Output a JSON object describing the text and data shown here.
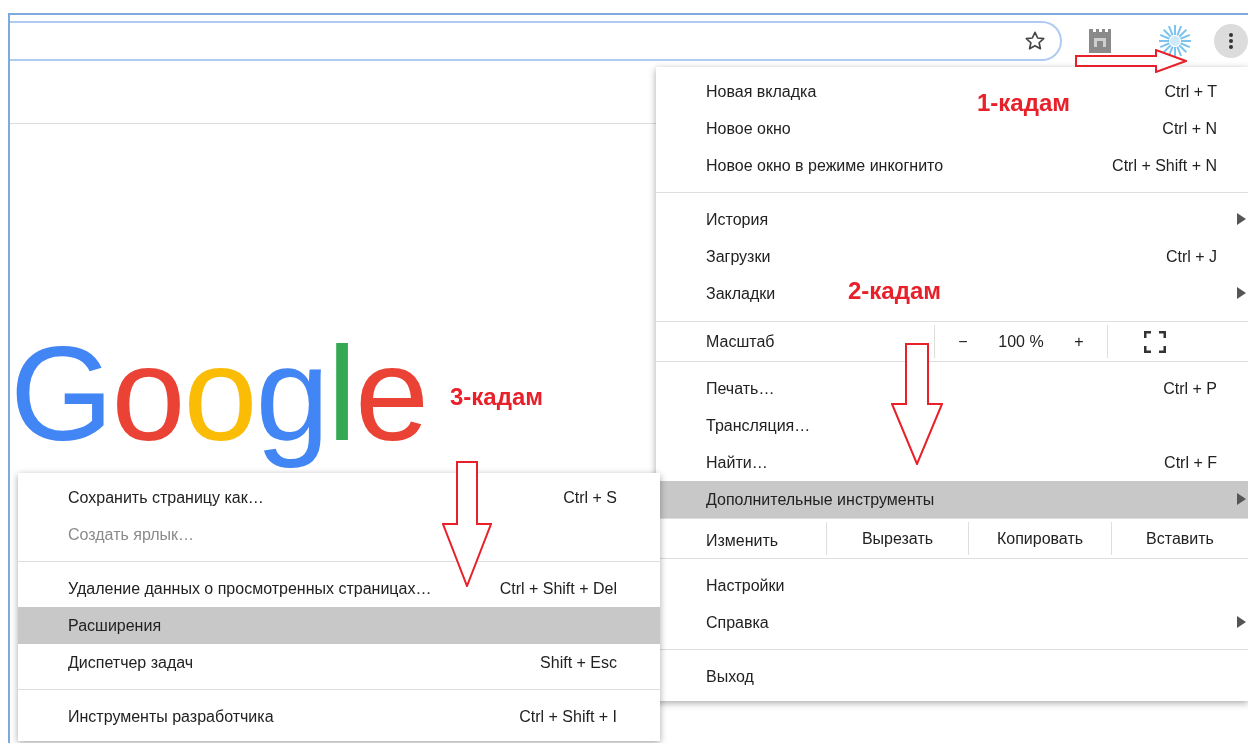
{
  "page": {
    "logo": "Google"
  },
  "menu": {
    "items": [
      {
        "kind": "item",
        "label": "Новая вкладка",
        "shortcut": "Ctrl + T",
        "selected": false
      },
      {
        "kind": "item",
        "label": "Новое окно",
        "shortcut": "Ctrl + N",
        "selected": false
      },
      {
        "kind": "item",
        "label": "Новое окно в режиме инкогнито",
        "shortcut": "Ctrl + Shift + N",
        "selected": false
      },
      {
        "kind": "separator"
      },
      {
        "kind": "item",
        "label": "История",
        "has_submenu": true,
        "selected": false
      },
      {
        "kind": "item",
        "label": "Загрузки",
        "shortcut": "Ctrl + J",
        "selected": false
      },
      {
        "kind": "item",
        "label": "Закладки",
        "has_submenu": true,
        "selected": false
      },
      {
        "kind": "zoom",
        "label": "Масштаб",
        "zoom_out": "−",
        "value": "100 %",
        "zoom_in": "+"
      },
      {
        "kind": "item",
        "label": "Печать…",
        "shortcut": "Ctrl + P",
        "selected": false
      },
      {
        "kind": "item",
        "label": "Трансляция…",
        "selected": false
      },
      {
        "kind": "item",
        "label": "Найти…",
        "shortcut": "Ctrl + F",
        "selected": false
      },
      {
        "kind": "item",
        "label": "Дополнительные инструменты",
        "has_submenu": true,
        "selected": true
      },
      {
        "kind": "edit",
        "label": "Изменить",
        "actions": [
          "Вырезать",
          "Копировать",
          "Вставить"
        ]
      },
      {
        "kind": "item",
        "label": "Настройки",
        "selected": false
      },
      {
        "kind": "item",
        "label": "Справка",
        "has_submenu": true,
        "selected": false
      },
      {
        "kind": "separator"
      },
      {
        "kind": "item",
        "label": "Выход",
        "selected": false
      }
    ]
  },
  "submenu": {
    "items": [
      {
        "kind": "item",
        "label": "Сохранить страницу как…",
        "shortcut": "Ctrl + S",
        "disabled": false,
        "selected": false
      },
      {
        "kind": "item",
        "label": "Создать ярлык…",
        "disabled": true,
        "selected": false
      },
      {
        "kind": "separator"
      },
      {
        "kind": "item",
        "label": "Удаление данных о просмотренных страницах…",
        "shortcut": "Ctrl + Shift + Del",
        "disabled": false,
        "selected": false
      },
      {
        "kind": "item",
        "label": "Расширения",
        "disabled": false,
        "selected": true
      },
      {
        "kind": "item",
        "label": "Диспетчер задач",
        "shortcut": "Shift + Esc",
        "disabled": false,
        "selected": false
      },
      {
        "kind": "separator"
      },
      {
        "kind": "item",
        "label": "Инструменты разработчика",
        "shortcut": "Ctrl + Shift + I",
        "disabled": false,
        "selected": false
      }
    ]
  },
  "annotations": [
    {
      "text": "1-кадам"
    },
    {
      "text": "2-кадам"
    },
    {
      "text": "3-кадам"
    }
  ]
}
